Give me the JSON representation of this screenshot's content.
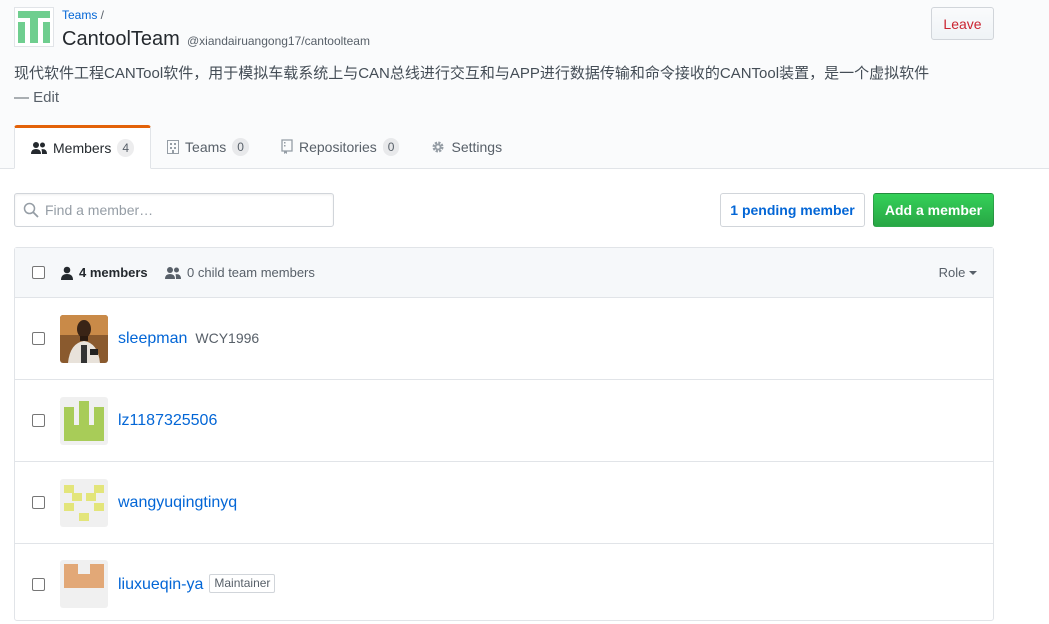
{
  "header": {
    "breadcrumb_link": "Teams",
    "breadcrumb_sep": " /",
    "title": "CantoolTeam",
    "handle": "@xiandairuangong17/cantoolteam",
    "leave_label": "Leave",
    "description": "现代软件工程CANTool软件，用于模拟车载系统上与CAN总线进行交互和与APP进行数据传输和命令接收的CANTool装置，是一个虚拟软件",
    "edit_prefix": "— ",
    "edit_label": "Edit"
  },
  "tabs": [
    {
      "label": "Members",
      "count": "4",
      "icon": "people-icon"
    },
    {
      "label": "Teams",
      "count": "0",
      "icon": "organization-icon"
    },
    {
      "label": "Repositories",
      "count": "0",
      "icon": "repo-icon"
    },
    {
      "label": "Settings",
      "count": "",
      "icon": "gear-icon"
    }
  ],
  "toolbar": {
    "search_placeholder": "Find a member…",
    "pending_label": "1 pending member",
    "add_label": "Add a member"
  },
  "table": {
    "members_label": "4 members",
    "child_label": "0 child team members",
    "role_label": "Role"
  },
  "members": [
    {
      "login": "sleepman",
      "name": "WCY1996",
      "badge": ""
    },
    {
      "login": "lz1187325506",
      "name": "",
      "badge": ""
    },
    {
      "login": "wangyuqingtinyq",
      "name": "",
      "badge": ""
    },
    {
      "login": "liuxueqin-ya",
      "name": "",
      "badge": "Maintainer"
    }
  ],
  "colors": {
    "accent": "#e36209",
    "link": "#0366d6",
    "primary_button": "#28a745",
    "danger": "#cb2431"
  }
}
